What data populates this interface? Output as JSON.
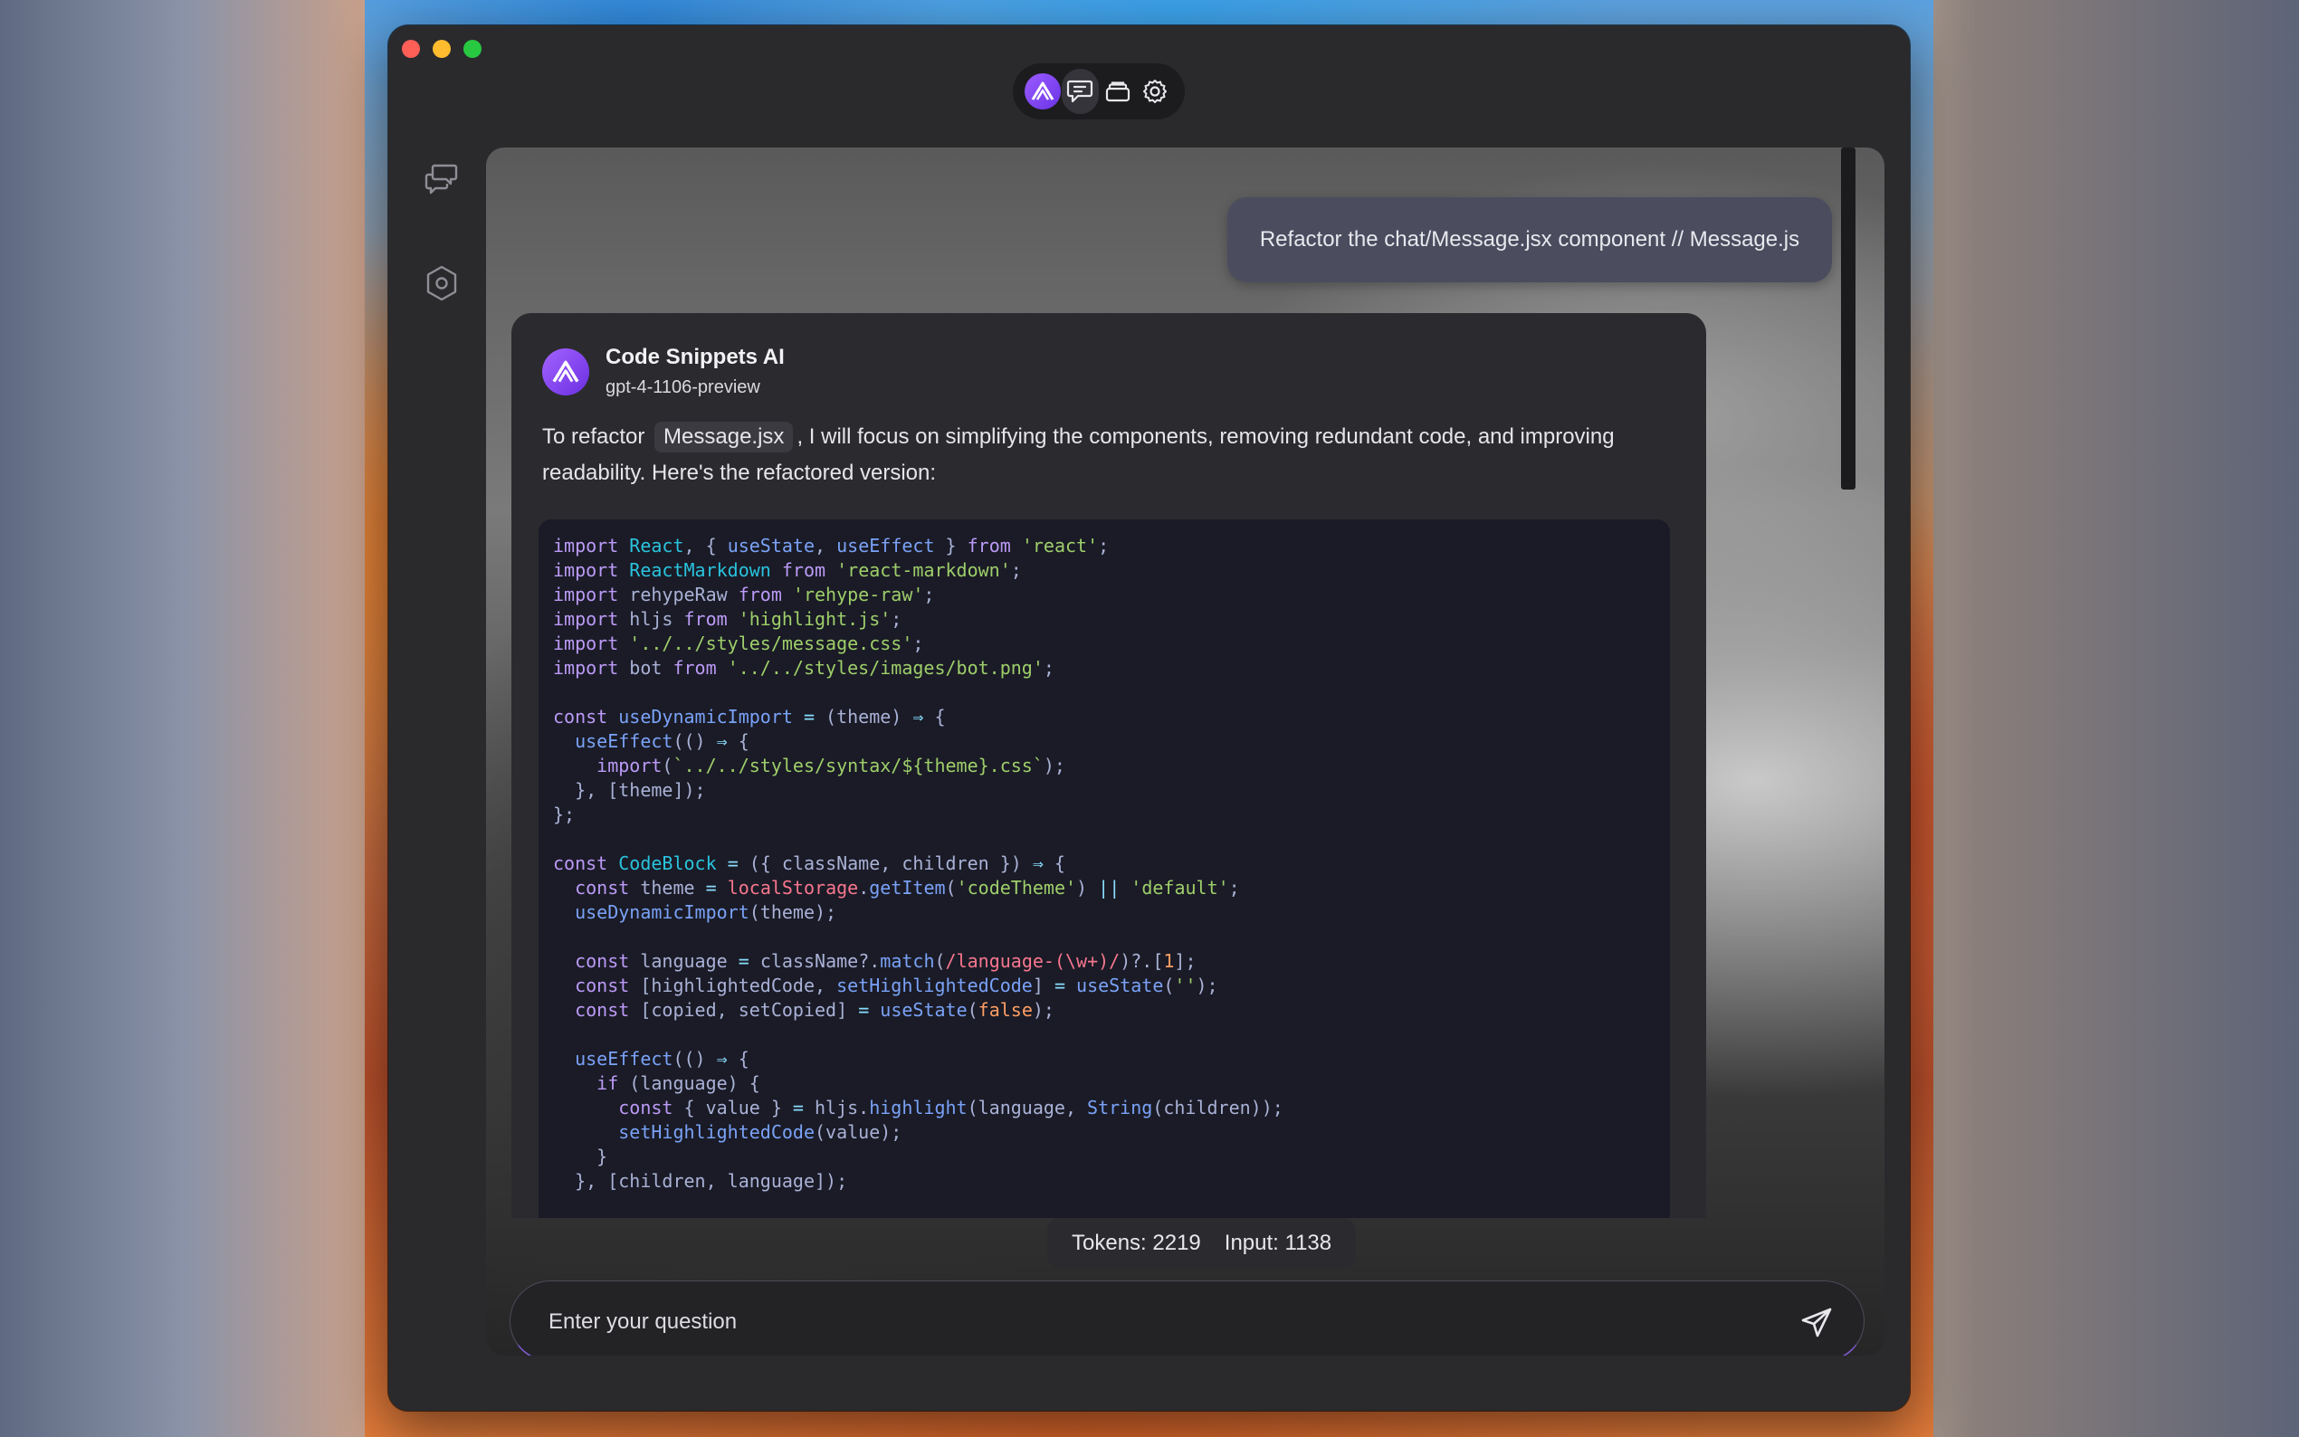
{
  "nav": {
    "logo_icon": "app-logo-icon",
    "items": [
      "chat-bubble-icon",
      "stack-icon",
      "gear-icon"
    ]
  },
  "sidebar": {
    "items": [
      "chat-threads-icon",
      "hexagon-settings-icon"
    ]
  },
  "user_message": {
    "text": "Refactor the chat/Message.jsx component // Message.js"
  },
  "bot": {
    "name": "Code Snippets AI",
    "model": "gpt-4-1106-preview",
    "intro_before": "To refactor ",
    "intro_code": "Message.jsx",
    "intro_after": ", I will focus on simplifying the components, removing redundant code, and improving readability. Here's the refactored version:"
  },
  "code_lines": [
    "import React, { useState, useEffect } from 'react';",
    "import ReactMarkdown from 'react-markdown';",
    "import rehypeRaw from 'rehype-raw';",
    "import hljs from 'highlight.js';",
    "import '../../styles/message.css';",
    "import bot from '../../styles/images/bot.png';",
    "",
    "const useDynamicImport = (theme) ⇒ {",
    "  useEffect(() ⇒ {",
    "    import(`../../styles/syntax/${theme}.css`);",
    "  }, [theme]);",
    "};",
    "",
    "const CodeBlock = ({ className, children }) ⇒ {",
    "  const theme = localStorage.getItem('codeTheme') || 'default';",
    "  useDynamicImport(theme);",
    "",
    "  const language = className?.match(/language-(\\w+)/)?.[1];",
    "  const [highlightedCode, setHighlightedCode] = useState('');",
    "  const [copied, setCopied] = useState(false);",
    "",
    "  useEffect(() ⇒ {",
    "    if (language) {",
    "      const { value } = hljs.highlight(language, String(children));",
    "      setHighlightedCode(value);",
    "    }",
    "  }, [children, language]);"
  ],
  "stats": {
    "tokens": "Tokens: 2219",
    "input": "Input: 1138"
  },
  "composer": {
    "placeholder": "Enter your question",
    "value": ""
  },
  "colors": {
    "accent": "#7c4dff",
    "user_bubble": "#4b4c5e",
    "code_bg": "#1a1b26"
  }
}
